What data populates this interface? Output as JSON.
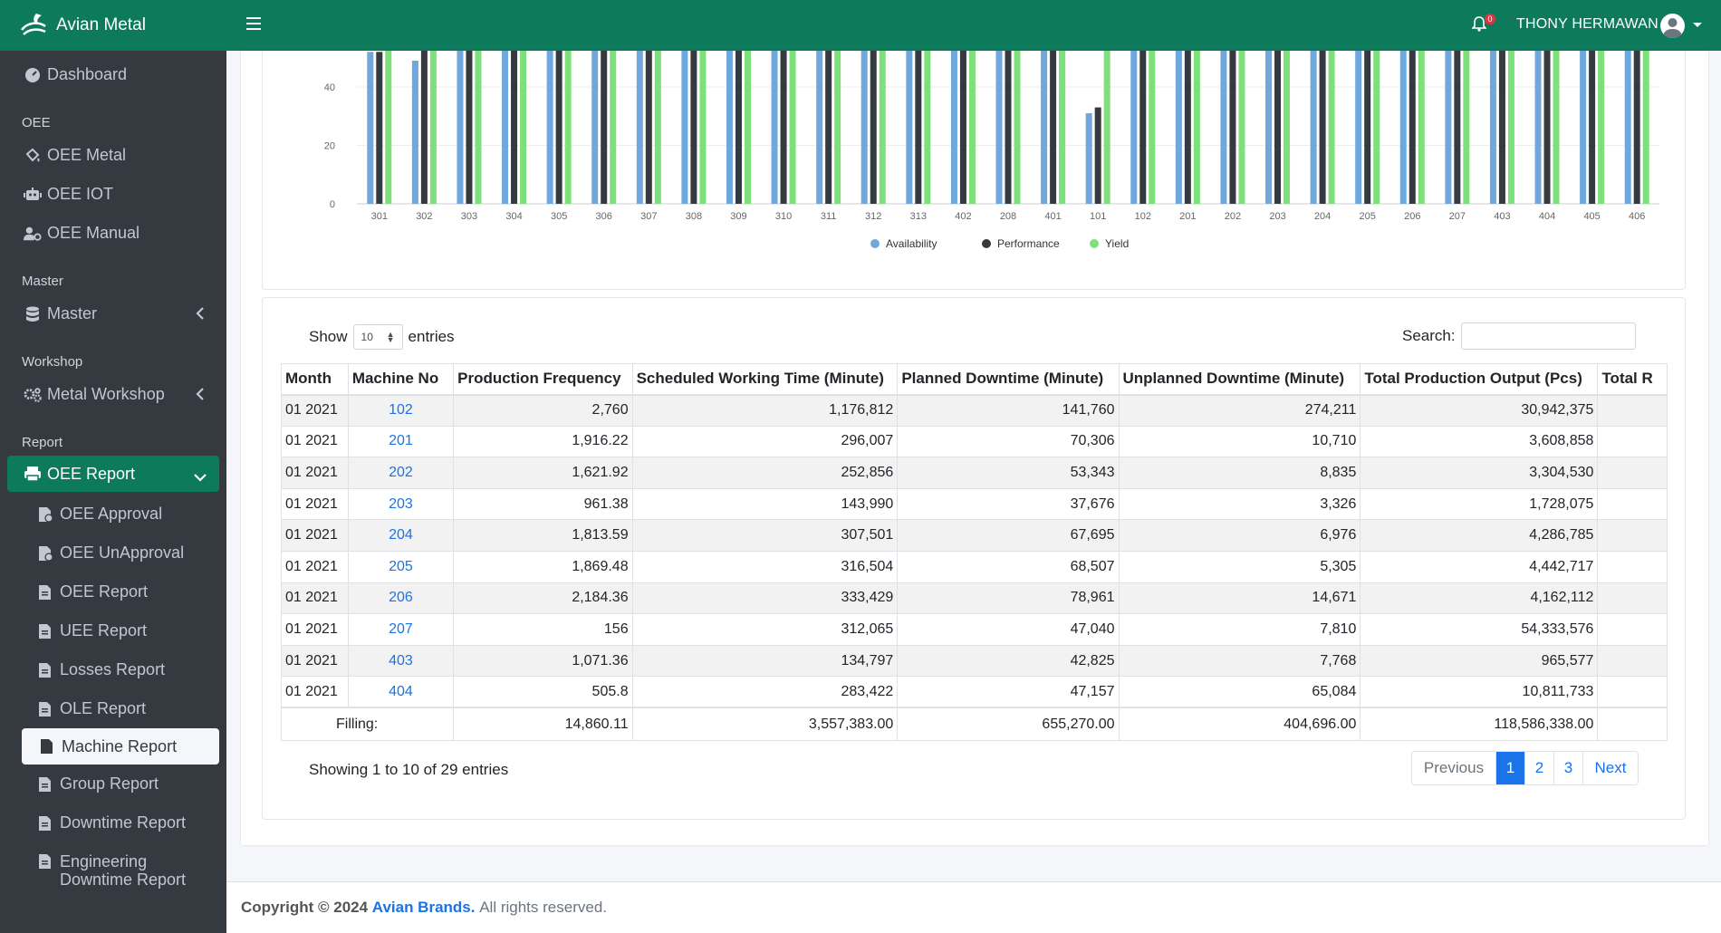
{
  "brand": {
    "name": "Avian Metal"
  },
  "sidebar": {
    "dashboard": "Dashboard",
    "sections": [
      {
        "header": "OEE",
        "items": [
          "OEE Metal",
          "OEE IOT",
          "OEE Manual"
        ]
      },
      {
        "header": "Master",
        "items": [
          "Master"
        ]
      },
      {
        "header": "Workshop",
        "items": [
          "Metal Workshop"
        ]
      },
      {
        "header": "Report",
        "items": [
          "OEE Report"
        ]
      }
    ],
    "report_sub": [
      "OEE Approval",
      "OEE UnApproval",
      "OEE Report",
      "UEE Report",
      "Losses Report",
      "OLE Report",
      "Machine Report",
      "Group Report",
      "Downtime Report",
      "Engineering Downtime Report"
    ]
  },
  "topbar": {
    "notification_count": "0",
    "user": "THONY HERMAWAN"
  },
  "chart_data": {
    "type": "bar",
    "categories": [
      "301",
      "302",
      "303",
      "304",
      "305",
      "306",
      "307",
      "308",
      "309",
      "310",
      "311",
      "312",
      "313",
      "402",
      "208",
      "401",
      "101",
      "102",
      "201",
      "202",
      "203",
      "204",
      "205",
      "206",
      "207",
      "403",
      "404",
      "405",
      "406"
    ],
    "series": [
      {
        "name": "Availability",
        "color": "#6fa8dc",
        "values": [
          52,
          49,
          98,
          98,
          98,
          98,
          98,
          98,
          98,
          98,
          98,
          98,
          98,
          98,
          98,
          98,
          31,
          98,
          98,
          98,
          98,
          98,
          98,
          98,
          98,
          98,
          98,
          98,
          98
        ]
      },
      {
        "name": "Performance",
        "color": "#343a40",
        "values": [
          52,
          98,
          98,
          98,
          98,
          98,
          98,
          98,
          98,
          98,
          98,
          98,
          98,
          98,
          98,
          98,
          33,
          98,
          98,
          98,
          98,
          98,
          98,
          98,
          98,
          98,
          98,
          98,
          98
        ]
      },
      {
        "name": "Yield",
        "color": "#7ee07a",
        "values": [
          98,
          98,
          98,
          98,
          98,
          98,
          98,
          98,
          98,
          98,
          98,
          98,
          98,
          98,
          98,
          98,
          98,
          98,
          98,
          98,
          98,
          98,
          98,
          98,
          98,
          98,
          98,
          98,
          98
        ]
      }
    ],
    "yticks": [
      "0",
      "20",
      "40"
    ],
    "ylim": [
      0,
      60
    ],
    "legend": "bottom"
  },
  "table": {
    "show_label": "Show",
    "entries_label": "entries",
    "length_value": "10",
    "search_label": "Search:",
    "columns": [
      "Month",
      "Machine No",
      "Production Frequency",
      "Scheduled Working Time (Minute)",
      "Planned Downtime (Minute)",
      "Unplanned Downtime (Minute)",
      "Total Production Output (Pcs)",
      "Total R"
    ],
    "rows": [
      [
        "01 2021",
        "102",
        "2,760",
        "1,176,812",
        "141,760",
        "274,211",
        "30,942,375",
        ""
      ],
      [
        "01 2021",
        "201",
        "1,916.22",
        "296,007",
        "70,306",
        "10,710",
        "3,608,858",
        ""
      ],
      [
        "01 2021",
        "202",
        "1,621.92",
        "252,856",
        "53,343",
        "8,835",
        "3,304,530",
        ""
      ],
      [
        "01 2021",
        "203",
        "961.38",
        "143,990",
        "37,676",
        "3,326",
        "1,728,075",
        ""
      ],
      [
        "01 2021",
        "204",
        "1,813.59",
        "307,501",
        "67,695",
        "6,976",
        "4,286,785",
        ""
      ],
      [
        "01 2021",
        "205",
        "1,869.48",
        "316,504",
        "68,507",
        "5,305",
        "4,442,717",
        ""
      ],
      [
        "01 2021",
        "206",
        "2,184.36",
        "333,429",
        "78,961",
        "14,671",
        "4,162,112",
        ""
      ],
      [
        "01 2021",
        "207",
        "156",
        "312,065",
        "47,040",
        "7,810",
        "54,333,576",
        ""
      ],
      [
        "01 2021",
        "403",
        "1,071.36",
        "134,797",
        "42,825",
        "7,768",
        "965,577",
        ""
      ],
      [
        "01 2021",
        "404",
        "505.8",
        "283,422",
        "47,157",
        "65,084",
        "10,811,733",
        ""
      ]
    ],
    "footer": [
      "Filling:",
      "14,860.11",
      "3,557,383.00",
      "655,270.00",
      "404,696.00",
      "118,586,338.00",
      ""
    ],
    "info": "Showing 1 to 10 of 29 entries",
    "pagination": {
      "prev": "Previous",
      "pages": [
        "1",
        "2",
        "3"
      ],
      "next": "Next"
    }
  },
  "footer": {
    "prefix": "Copyright © 2024",
    "brand": "Avian Brands.",
    "suffix": "All rights reserved."
  }
}
